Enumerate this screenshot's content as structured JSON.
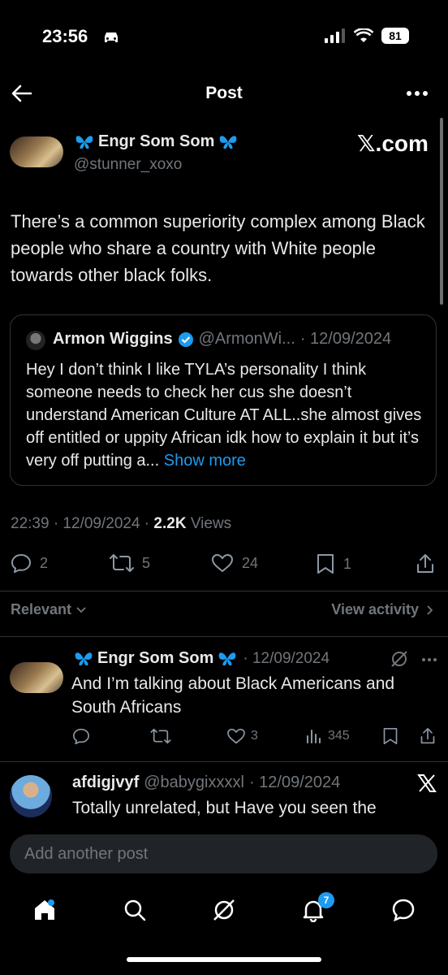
{
  "status_bar": {
    "time": "23:56",
    "battery": "81"
  },
  "header": {
    "title": "Post"
  },
  "post": {
    "author_name": "Engr Som Som",
    "author_handle": "@stunner_xoxo",
    "watermark": "𝕏.com",
    "text": "There’s a common superiority complex among Black people who share a country with White people towards other black folks.",
    "timestamp": "22:39 · 12/09/2024 ·",
    "views_count": "2.2K",
    "views_label": "Views",
    "replies": "2",
    "reposts": "5",
    "likes": "24",
    "bookmarks": "1"
  },
  "quote": {
    "author_name": "Armon Wiggins",
    "author_handle": "@ArmonWi...",
    "date": "· 12/09/2024",
    "text": "Hey I don’t think I like TYLA’s personality I think someone needs to check her cus she doesn’t understand American Culture AT ALL..she almost gives off entitled or uppity African  idk how to explain it but it’s very off putting a...",
    "show_more": "Show more"
  },
  "sort": {
    "label": "Relevant",
    "activity": "View activity"
  },
  "replies": [
    {
      "author_name": "Engr Som Som",
      "date": "· 12/09/2024",
      "text": "And I’m talking about Black Americans and South Africans",
      "likes": "3",
      "views": "345"
    },
    {
      "author_name": "afdigjvyf",
      "author_handle": "@babygixxxxl",
      "date": "· 12/09/2024",
      "text": "Totally unrelated,  but Have you seen the"
    }
  ],
  "composer": {
    "placeholder": "Add another post"
  },
  "tabbar": {
    "notifications_badge": "7"
  },
  "colors": {
    "accent": "#1d9bf0",
    "background": "#000000",
    "muted": "#71767b",
    "border": "#2f3336"
  }
}
